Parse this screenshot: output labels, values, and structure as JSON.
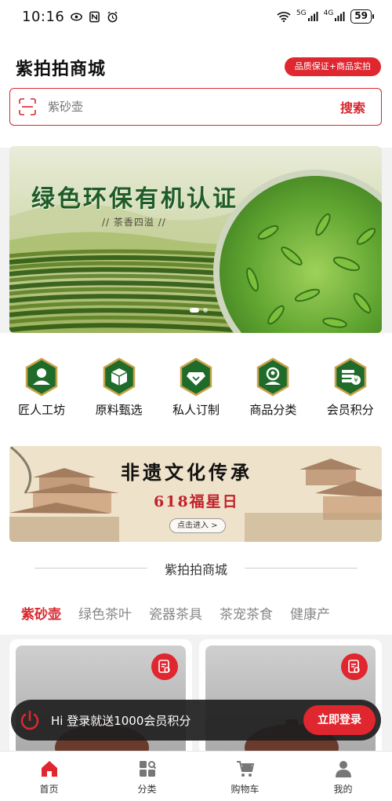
{
  "status_bar": {
    "time": "10:16",
    "network_5g": "5G",
    "network_4g": "4G",
    "battery": "59"
  },
  "header": {
    "title": "紫拍拍商城",
    "badge": "品质保证+商品实拍"
  },
  "search": {
    "placeholder": "紫砂壶",
    "button_label": "搜索"
  },
  "banner": {
    "title": "绿色环保有机认证",
    "subtitle": "// 茶香四溢 //"
  },
  "categories": [
    {
      "label": "匠人工坊",
      "icon": "craftsman-icon"
    },
    {
      "label": "原料甄选",
      "icon": "box-icon"
    },
    {
      "label": "私人订制",
      "icon": "diamond-icon"
    },
    {
      "label": "商品分类",
      "icon": "category-icon"
    },
    {
      "label": "会员积分",
      "icon": "points-icon"
    }
  ],
  "promo": {
    "title": "非遗文化传承",
    "subtitle": "618福星日",
    "button": "点击进入 >"
  },
  "section": {
    "title": "紫拍拍商城"
  },
  "tabs": [
    {
      "label": "紫砂壶",
      "active": true
    },
    {
      "label": "绿色茶叶",
      "active": false
    },
    {
      "label": "瓷器茶具",
      "active": false
    },
    {
      "label": "茶宠茶食",
      "active": false
    },
    {
      "label": "健康产",
      "active": false
    }
  ],
  "login_bar": {
    "text": "Hi 登录就送1000会员积分",
    "button": "立即登录"
  },
  "bottom_nav": [
    {
      "label": "首页",
      "icon": "home-icon",
      "active": true
    },
    {
      "label": "分类",
      "icon": "category-grid-icon",
      "active": false
    },
    {
      "label": "购物车",
      "icon": "cart-icon",
      "active": false
    },
    {
      "label": "我的",
      "icon": "user-icon",
      "active": false
    }
  ],
  "colors": {
    "brand_red": "#e0262f",
    "icon_green": "#1e6b2a"
  }
}
